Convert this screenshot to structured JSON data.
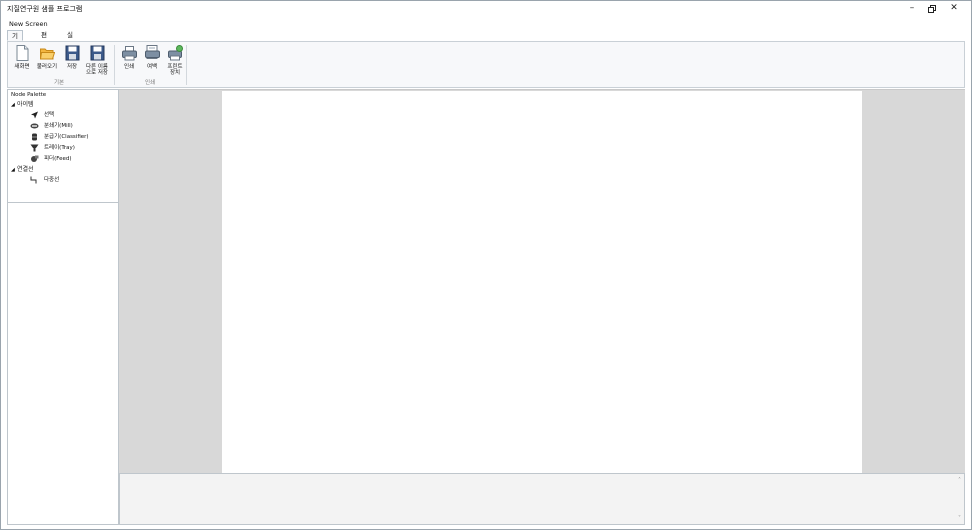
{
  "window": {
    "title": "지질연구원 샘플 프로그램"
  },
  "menubar": {
    "screen": "New Screen"
  },
  "ribbon_tabs": [
    {
      "label": "기본",
      "active": true
    },
    {
      "label": "편집",
      "active": false
    },
    {
      "label": "실행",
      "active": false
    }
  ],
  "ribbon": {
    "groups": [
      {
        "label": "기본",
        "buttons": [
          "새화면",
          "불러오기",
          "저장",
          "다른 이름\n으로 저장"
        ]
      },
      {
        "label": "인쇄",
        "buttons": [
          "인쇄",
          "여백",
          "프린트\n장치"
        ]
      }
    ]
  },
  "palette": {
    "title": "Node Palette",
    "categories": [
      {
        "label": "아이템",
        "items": [
          "선택",
          "분쇄기(Mill)",
          "분급기(Classifier)",
          "트레이(Tray)",
          "피더(Feed)"
        ]
      },
      {
        "label": "연결선",
        "items": [
          "다중선"
        ]
      }
    ]
  },
  "colors": {
    "canvas_bg": "#d8d8d8",
    "paper": "#ffffff",
    "ribbon_bg": "#f7f8fa"
  }
}
